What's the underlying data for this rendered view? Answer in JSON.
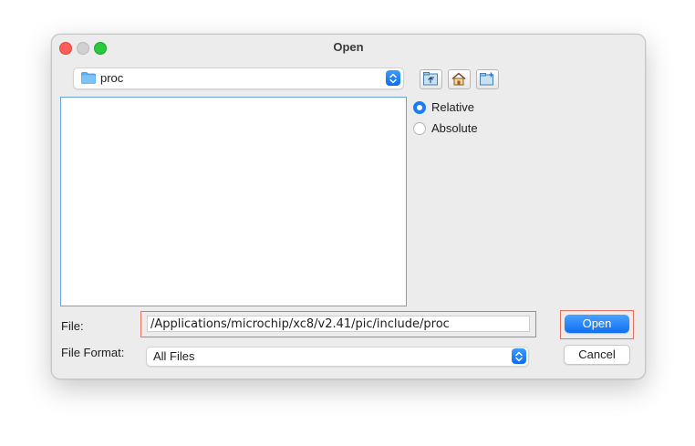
{
  "window": {
    "title": "Open"
  },
  "folder_combo": {
    "value": "proc",
    "icon": "folder-icon"
  },
  "toolbar": {
    "buttons": [
      {
        "icon": "up-folder-icon"
      },
      {
        "icon": "home-icon"
      },
      {
        "icon": "new-folder-icon"
      }
    ]
  },
  "path_mode": {
    "options": [
      {
        "label": "Relative",
        "selected": true
      },
      {
        "label": "Absolute",
        "selected": false
      }
    ]
  },
  "file_field": {
    "label": "File:",
    "value": "/Applications/microchip/xc8/v2.41/pic/include/proc"
  },
  "format_field": {
    "label": "File Format:",
    "value": "All Files"
  },
  "buttons": {
    "open": "Open",
    "cancel": "Cancel"
  },
  "colors": {
    "accent": "#1a7cf7",
    "highlight_outline": "#e8705f"
  }
}
